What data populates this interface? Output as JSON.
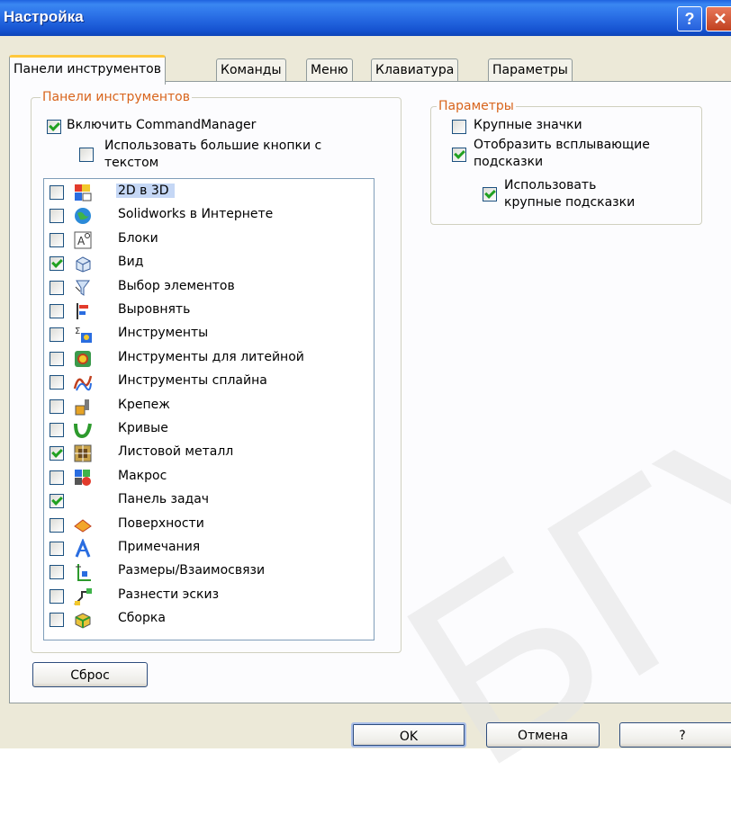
{
  "window": {
    "title": "Настройка",
    "help": "?",
    "close": "✕"
  },
  "tabs": [
    {
      "label": "Панели инструментов",
      "active": true
    },
    {
      "label": "Команды",
      "active": false
    },
    {
      "label": "Меню",
      "active": false
    },
    {
      "label": "Клавиатура",
      "active": false
    },
    {
      "label": "Параметры",
      "active": false
    }
  ],
  "toolbars_group": {
    "legend": "Панели инструментов",
    "enable_cm": {
      "label": "Включить CommandManager",
      "checked": true
    },
    "big_buttons": {
      "label_line1": "Использовать большие кнопки с",
      "label_line2": "текстом",
      "checked": false
    }
  },
  "toolbar_list": [
    {
      "label": "2D в 3D",
      "checked": false,
      "icon": "2d-to-3d-icon",
      "selected": true
    },
    {
      "label": "Solidworks в Интернете",
      "checked": false,
      "icon": "globe-icon"
    },
    {
      "label": "Блоки",
      "checked": false,
      "icon": "blocks-icon"
    },
    {
      "label": "Вид",
      "checked": true,
      "icon": "view-icon"
    },
    {
      "label": "Выбор элементов",
      "checked": false,
      "icon": "selection-filter-icon"
    },
    {
      "label": "Выровнять",
      "checked": false,
      "icon": "align-icon"
    },
    {
      "label": "Инструменты",
      "checked": false,
      "icon": "tools-icon"
    },
    {
      "label": "Инструменты для литейной",
      "checked": false,
      "icon": "mold-tools-icon"
    },
    {
      "label": "Инструменты сплайна",
      "checked": false,
      "icon": "spline-tools-icon"
    },
    {
      "label": "Крепеж",
      "checked": false,
      "icon": "fastening-icon"
    },
    {
      "label": "Кривые",
      "checked": false,
      "icon": "curves-icon"
    },
    {
      "label": "Листовой металл",
      "checked": true,
      "icon": "sheet-metal-icon"
    },
    {
      "label": "Макрос",
      "checked": false,
      "icon": "macro-icon"
    },
    {
      "label": "Панель задач",
      "checked": true,
      "icon": ""
    },
    {
      "label": "Поверхности",
      "checked": false,
      "icon": "surfaces-icon"
    },
    {
      "label": "Примечания",
      "checked": false,
      "icon": "annotations-icon"
    },
    {
      "label": "Размеры/Взаимосвязи",
      "checked": false,
      "icon": "dimensions-icon"
    },
    {
      "label": "Разнести эскиз",
      "checked": false,
      "icon": "explode-sketch-icon"
    },
    {
      "label": "Сборка",
      "checked": false,
      "icon": "assembly-icon"
    }
  ],
  "params_group": {
    "legend": "Параметры",
    "large_icons": {
      "label": "Крупные значки",
      "checked": false
    },
    "tooltips": {
      "label_line1": "Отобразить всплывающие",
      "label_line2": "подсказки",
      "checked": true
    },
    "large_tooltips": {
      "label_line1": "Использовать",
      "label_line2": "крупные подсказки",
      "checked": true
    }
  },
  "buttons": {
    "reset": "Сброс",
    "ok": "OK",
    "cancel": "Отмена",
    "help": "?"
  },
  "watermark": "БГУИ",
  "colors": {
    "title_bar": "#2a6fe6",
    "legend": "#d8641b",
    "check": "#21a121",
    "selection": "#c5d7f5"
  }
}
